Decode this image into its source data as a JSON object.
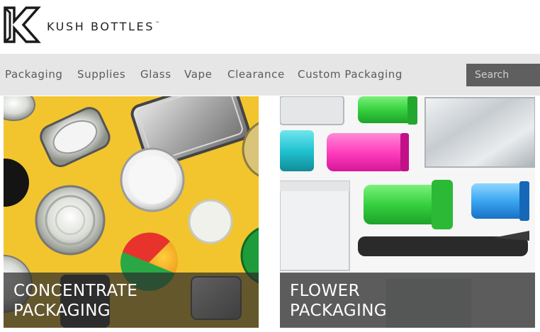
{
  "brand": {
    "name": "KUSH BOTTLES",
    "trademark": "™"
  },
  "nav": {
    "items": [
      {
        "label": "Packaging"
      },
      {
        "label": "Supplies"
      },
      {
        "label": "Glass"
      },
      {
        "label": "Vape"
      },
      {
        "label": "Clearance"
      },
      {
        "label": "Custom Packaging"
      }
    ]
  },
  "search": {
    "placeholder": "Search"
  },
  "tiles": [
    {
      "line1": "CONCENTRATE",
      "line2": "PACKAGING"
    },
    {
      "line1": "FLOWER",
      "line2": "PACKAGING"
    }
  ],
  "colors": {
    "nav_bg": "#e6e6e6",
    "search_bg": "#5f5f5f",
    "concentrate_bg": "#f2c52e",
    "caption_overlay": "rgba(45,45,45,0.72)"
  }
}
